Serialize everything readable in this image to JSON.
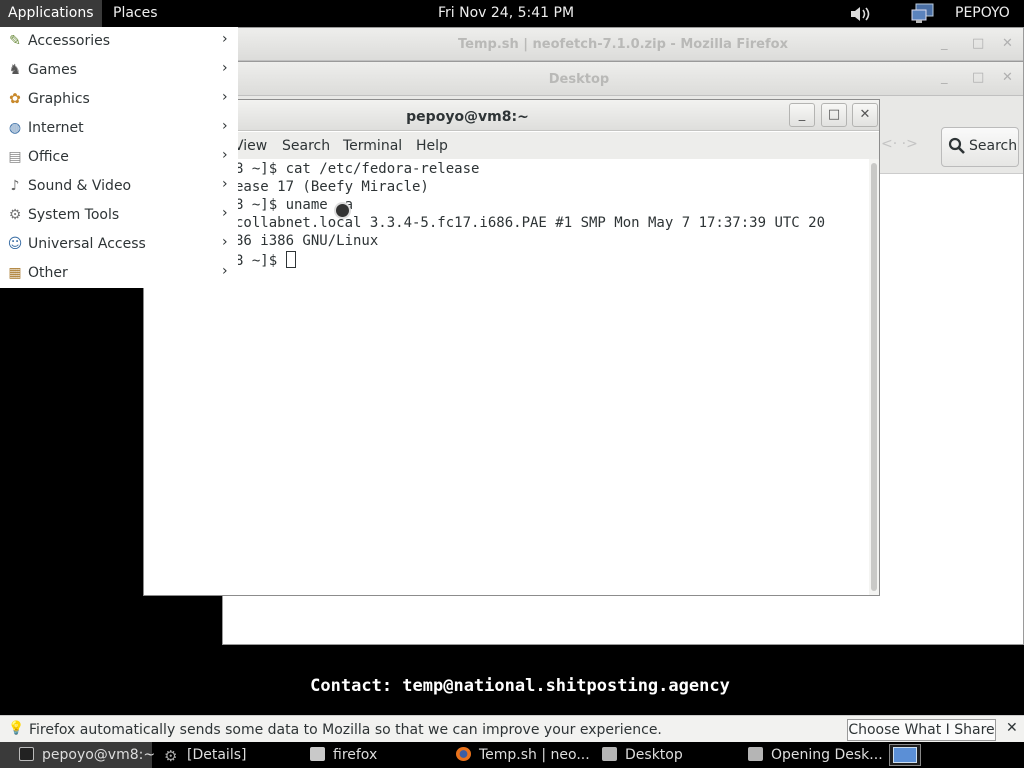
{
  "top_panel": {
    "applications": "Applications",
    "places": "Places",
    "clock": "Fri Nov 24,  5:41 PM",
    "user": "PEPOYO",
    "volume_icon": "volume-icon",
    "network_icon": "network-icon"
  },
  "app_menu": {
    "items": [
      {
        "label": "Accessories",
        "icon": "accessories-icon"
      },
      {
        "label": "Games",
        "icon": "games-icon"
      },
      {
        "label": "Graphics",
        "icon": "graphics-icon"
      },
      {
        "label": "Internet",
        "icon": "internet-icon"
      },
      {
        "label": "Office",
        "icon": "office-icon"
      },
      {
        "label": "Sound & Video",
        "icon": "sound-video-icon"
      },
      {
        "label": "System Tools",
        "icon": "system-tools-icon"
      },
      {
        "label": "Universal Access",
        "icon": "universal-access-icon"
      },
      {
        "label": "Other",
        "icon": "other-icon"
      }
    ]
  },
  "firefox_window": {
    "title": "Temp.sh | neofetch-7.1.0.zip - Mozilla Firefox"
  },
  "desktop_window": {
    "title": "Desktop",
    "search_label": "Search"
  },
  "terminal": {
    "title": "pepoyo@vm8:~",
    "menu": [
      "View",
      "Search",
      "Terminal",
      "Help"
    ],
    "lines": [
      "8 ~]$ cat /etc/fedora-release",
      "ease 17 (Beefy Miracle)",
      "8 ~]$ uname -a",
      "collabnet.local 3.3.4-5.fc17.i686.PAE #1 SMP Mon May 7 17:37:39 UTC 20",
      "86 i386 GNU/Linux",
      "8 ~]$ "
    ]
  },
  "contact_text": "Contact: temp@national.shitposting.agency",
  "notification": {
    "text": "Firefox automatically sends some data to Mozilla so that we can improve your experience.",
    "button": "Choose What I Share",
    "close": "✕"
  },
  "taskbar": {
    "items": [
      {
        "label": "pepoyo@vm8:~",
        "icon": "terminal-icon"
      },
      {
        "label": "[Details]",
        "icon": "gear-icon"
      },
      {
        "label": "firefox",
        "icon": "folder-icon"
      },
      {
        "label": "Temp.sh | neo...",
        "icon": "firefox-icon"
      },
      {
        "label": "Desktop",
        "icon": "folder-camera-icon"
      },
      {
        "label": "Opening Desk...",
        "icon": "folder-camera-icon"
      }
    ]
  },
  "colors": {
    "panel": "#000000",
    "menu_bg": "#ffffff",
    "window_chrome": "#e9e9e7",
    "terminal_text": "#2e3436"
  }
}
